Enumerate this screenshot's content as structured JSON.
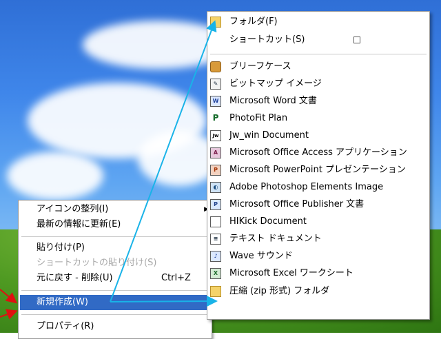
{
  "context_menu": {
    "items": [
      {
        "label": "アイコンの整列(I)",
        "has_submenu": true
      },
      {
        "label": "最新の情報に更新(E)"
      },
      {
        "label": "貼り付け(P)"
      },
      {
        "label": "ショートカットの貼り付け(S)",
        "disabled": true
      },
      {
        "label": "元に戻す - 削除(U)",
        "shortcut": "Ctrl+Z"
      },
      {
        "label": "新規作成(W)",
        "has_submenu": true,
        "highlighted": true
      },
      {
        "label": "プロパティ(R)"
      }
    ]
  },
  "submenu": {
    "items": [
      {
        "label": "フォルダ(F)",
        "icon": "folder-icon"
      },
      {
        "label": "ショートカット(S)",
        "icon": "shortcut-icon"
      },
      {
        "label": "ブリーフケース",
        "icon": "briefcase-icon"
      },
      {
        "label": "ビットマップ イメージ",
        "icon": "bitmap-icon"
      },
      {
        "label": "Microsoft Word 文書",
        "icon": "word-icon"
      },
      {
        "label": "PhotoFit Plan",
        "icon": "photofit-icon"
      },
      {
        "label": "Jw_win Document",
        "icon": "jw-icon"
      },
      {
        "label": "Microsoft Office Access アプリケーション",
        "icon": "access-icon"
      },
      {
        "label": "Microsoft PowerPoint プレゼンテーション",
        "icon": "powerpoint-icon"
      },
      {
        "label": "Adobe Photoshop Elements Image",
        "icon": "photoshop-icon"
      },
      {
        "label": "Microsoft Office Publisher 文書",
        "icon": "publisher-icon"
      },
      {
        "label": "HIKick Document",
        "icon": "hikick-icon"
      },
      {
        "label": "テキスト ドキュメント",
        "icon": "text-document-icon"
      },
      {
        "label": "Wave サウンド",
        "icon": "wave-icon"
      },
      {
        "label": "Microsoft Excel ワークシート",
        "icon": "excel-icon"
      },
      {
        "label": "圧縮 (zip 形式) フォルダ",
        "icon": "zip-folder-icon"
      }
    ]
  },
  "colors": {
    "highlight": "#316ac5",
    "annotation_arrow_blue": "#19b3e8",
    "annotation_arrow_red": "#e01010"
  }
}
